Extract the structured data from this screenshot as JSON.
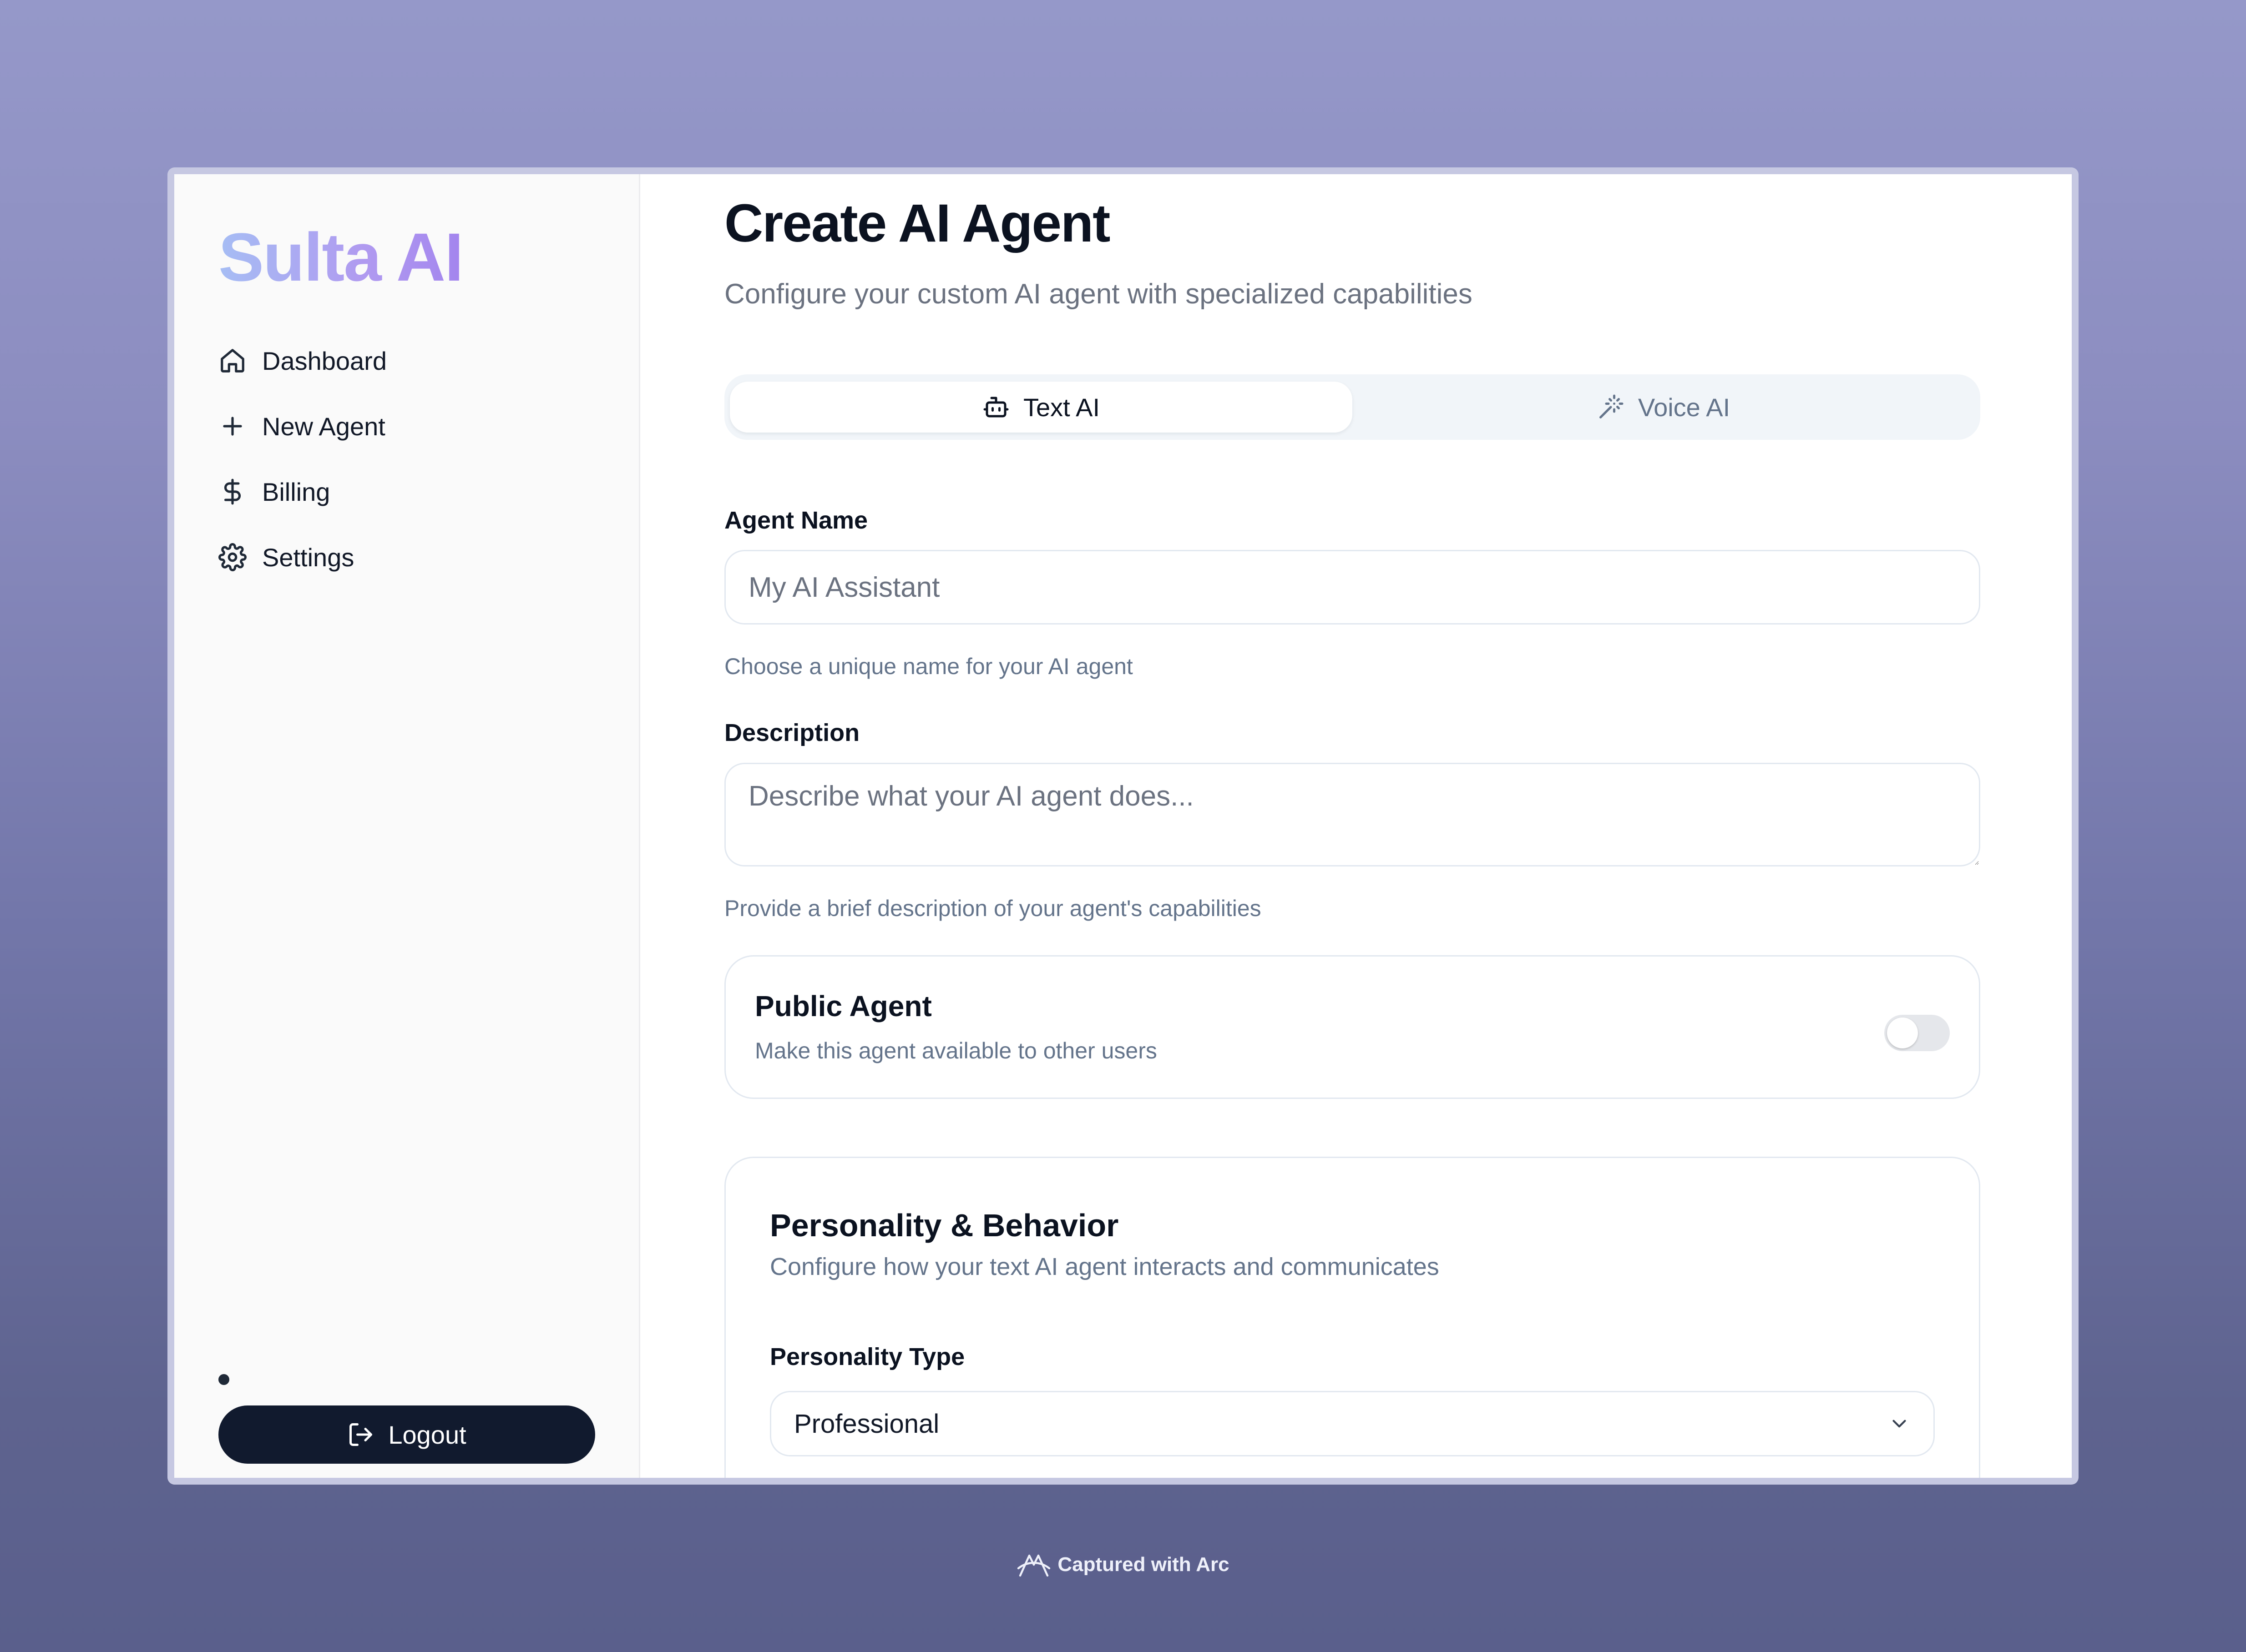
{
  "sidebar": {
    "brand": "Sulta AI",
    "items": [
      {
        "label": "Dashboard",
        "icon": "home-icon"
      },
      {
        "label": "New Agent",
        "icon": "plus-icon"
      },
      {
        "label": "Billing",
        "icon": "dollar-icon"
      },
      {
        "label": "Settings",
        "icon": "gear-icon"
      }
    ],
    "logout_label": "Logout"
  },
  "main": {
    "title": "Create AI Agent",
    "subtitle": "Configure your custom AI agent with specialized capabilities",
    "tabs": [
      {
        "label": "Text AI",
        "icon": "bot-icon",
        "active": true
      },
      {
        "label": "Voice AI",
        "icon": "wand-icon",
        "active": false
      }
    ],
    "agent_name": {
      "label": "Agent Name",
      "placeholder": "My AI Assistant",
      "value": "",
      "hint": "Choose a unique name for your AI agent"
    },
    "description": {
      "label": "Description",
      "placeholder": "Describe what your AI agent does...",
      "value": "",
      "hint": "Provide a brief description of your agent's capabilities"
    },
    "public_agent": {
      "title": "Public Agent",
      "description": "Make this agent available to other users",
      "enabled": false
    },
    "personality": {
      "title": "Personality & Behavior",
      "description": "Configure how your text AI agent interacts and communicates",
      "type_label": "Personality Type",
      "type_value": "Professional"
    }
  },
  "footer": {
    "capture_text": "Captured with Arc"
  },
  "colors": {
    "primary_dark": "#111a2e",
    "brand_gradient_start": "#a6bdf4",
    "brand_gradient_end": "#a385ee",
    "muted_text": "#64748b"
  }
}
